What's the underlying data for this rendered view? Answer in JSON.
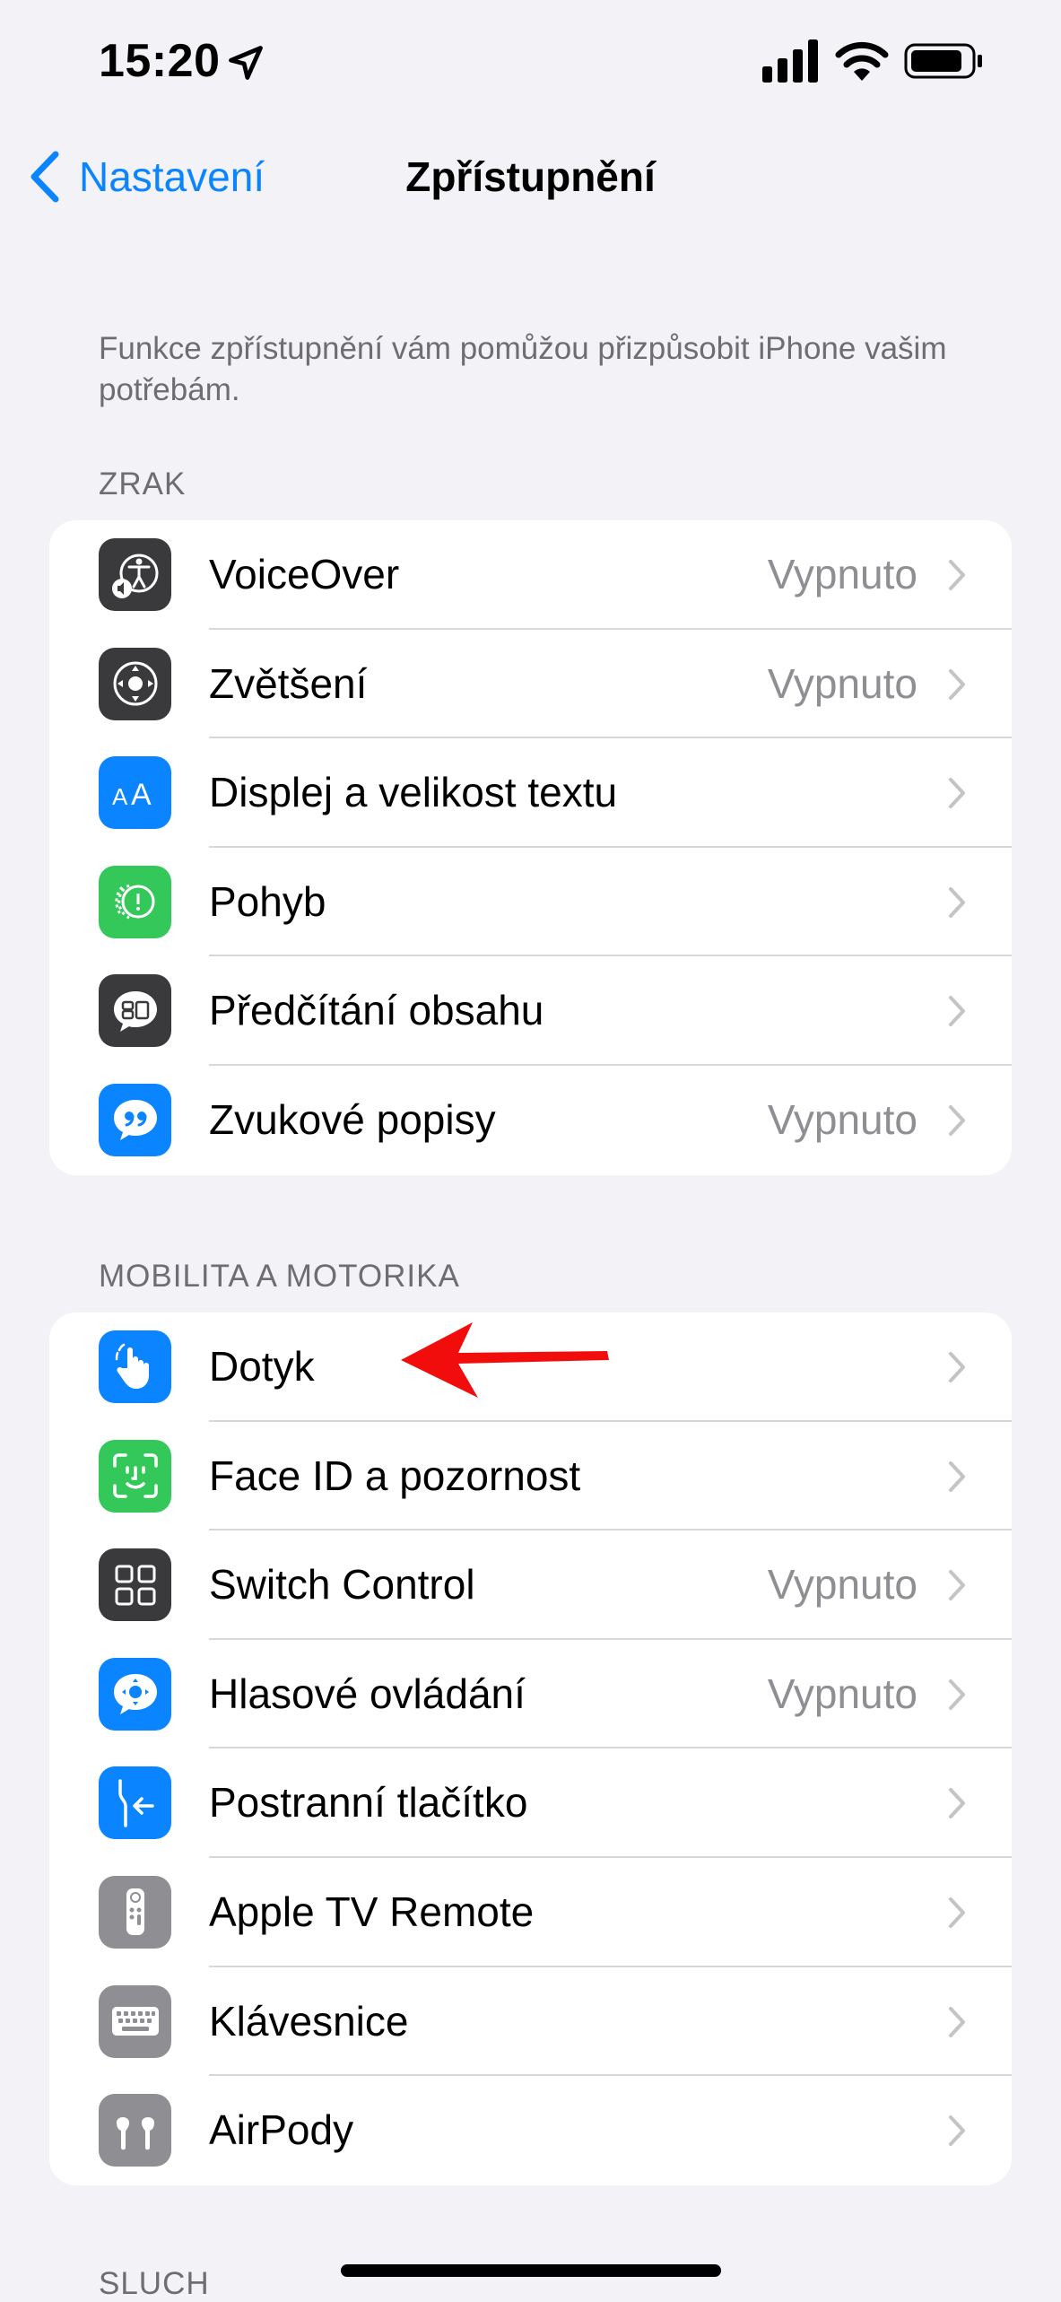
{
  "status": {
    "time": "15:20"
  },
  "nav": {
    "back_label": "Nastavení",
    "title": "Zpřístupnění"
  },
  "intro_text": "Funkce zpřístupnění vám pomůžou přizpůsobit iPhone vašim potřebám.",
  "sections": [
    {
      "header": "ZRAK",
      "items": [
        {
          "label": "VoiceOver",
          "value": "Vypnuto",
          "icon": "voiceover-icon",
          "icon_color": "#3a3a3c"
        },
        {
          "label": "Zvětšení",
          "value": "Vypnuto",
          "icon": "zoom-icon",
          "icon_color": "#3a3a3c"
        },
        {
          "label": "Displej a velikost textu",
          "value": "",
          "icon": "text-size-icon",
          "icon_color": "#0a84ff"
        },
        {
          "label": "Pohyb",
          "value": "",
          "icon": "motion-icon",
          "icon_color": "#34c759"
        },
        {
          "label": "Předčítání obsahu",
          "value": "",
          "icon": "spoken-content-icon",
          "icon_color": "#3a3a3c"
        },
        {
          "label": "Zvukové popisy",
          "value": "Vypnuto",
          "icon": "audio-descriptions-icon",
          "icon_color": "#0a84ff"
        }
      ]
    },
    {
      "header": "MOBILITA A MOTORIKA",
      "items": [
        {
          "label": "Dotyk",
          "value": "",
          "icon": "touch-hand-icon",
          "icon_color": "#0a84ff"
        },
        {
          "label": "Face ID a pozornost",
          "value": "",
          "icon": "face-id-icon",
          "icon_color": "#34c759"
        },
        {
          "label": "Switch Control",
          "value": "Vypnuto",
          "icon": "switch-control-icon",
          "icon_color": "#3a3a3c"
        },
        {
          "label": "Hlasové ovládání",
          "value": "Vypnuto",
          "icon": "voice-control-icon",
          "icon_color": "#0a84ff"
        },
        {
          "label": "Postranní tlačítko",
          "value": "",
          "icon": "side-button-icon",
          "icon_color": "#0a84ff"
        },
        {
          "label": "Apple TV Remote",
          "value": "",
          "icon": "apple-tv-remote-icon",
          "icon_color": "#8e8e93"
        },
        {
          "label": "Klávesnice",
          "value": "",
          "icon": "keyboard-icon",
          "icon_color": "#8e8e93"
        },
        {
          "label": "AirPody",
          "value": "",
          "icon": "airpods-icon",
          "icon_color": "#8e8e93"
        }
      ]
    },
    {
      "header": "SLUCH"
    }
  ],
  "annotation": {
    "arrow_color": "#f20d0d"
  }
}
